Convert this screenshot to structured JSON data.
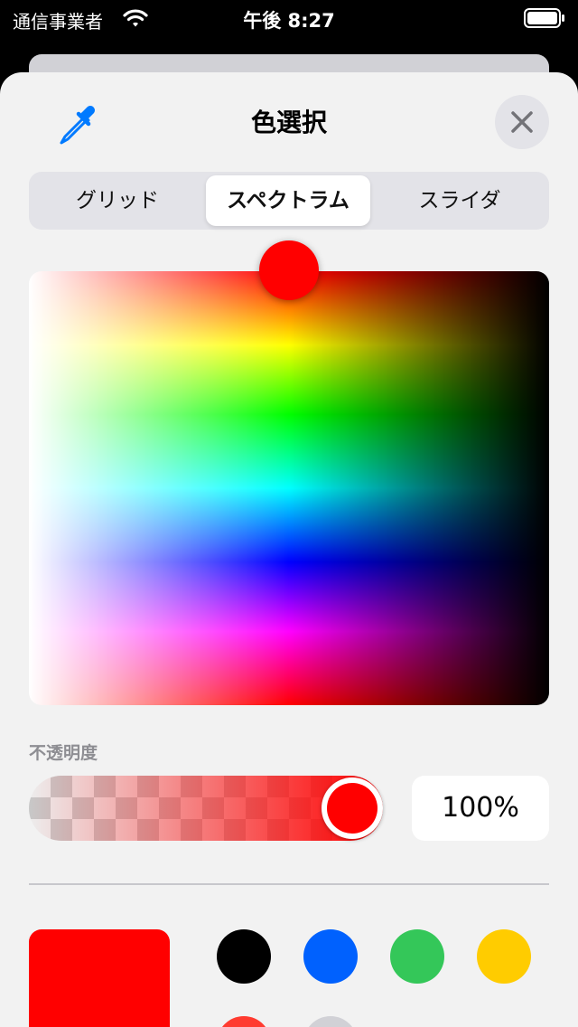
{
  "status_bar": {
    "carrier": "通信事業者",
    "time": "午後 8:27"
  },
  "sheet": {
    "title": "色選択",
    "segments": [
      "グリッド",
      "スペクトラム",
      "スライダ"
    ],
    "selected_segment": "スペクトラム",
    "opacity_label": "不透明度",
    "opacity_value": "100%",
    "current_color": "#ff0000"
  },
  "swatches": [
    {
      "color": "#000000"
    },
    {
      "color": "#0061fe"
    },
    {
      "color": "#34c759"
    },
    {
      "color": "#ffcc00"
    },
    {
      "color": "#ff3b30"
    },
    {
      "color": "#d1d1d6"
    }
  ],
  "colors": {
    "accent": "#007aff",
    "selected_color": "#ff0000"
  },
  "icons": [
    "wifi-icon",
    "battery-icon",
    "eyedropper-icon",
    "close-icon"
  ]
}
